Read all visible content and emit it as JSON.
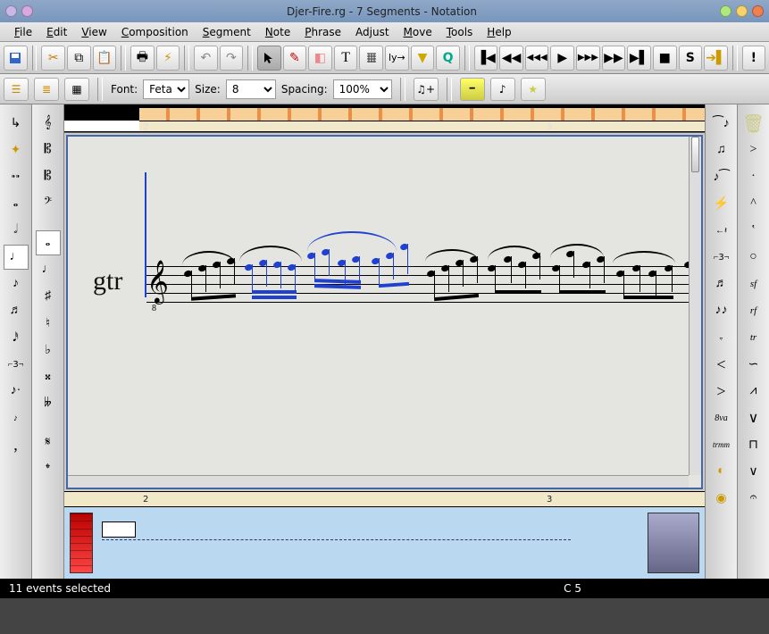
{
  "window": {
    "title": "Djer-Fire.rg - 7 Segments - Notation"
  },
  "menu": {
    "items": [
      "File",
      "Edit",
      "View",
      "Composition",
      "Segment",
      "Note",
      "Phrase",
      "Adjust",
      "Move",
      "Tools",
      "Help"
    ]
  },
  "toolbar_main": {
    "save": "save-icon",
    "cut": "cut-icon",
    "copy": "copy-icon",
    "paste": "paste-icon",
    "print": "print-icon",
    "preview": "preview-icon",
    "undo": "undo-icon",
    "redo": "redo-icon",
    "select": "arrow-icon",
    "draw": "pencil-icon",
    "erase": "eraser-icon",
    "text": "T",
    "guitar": "fret-icon",
    "lilypond": "ly-icon",
    "filter": "filter-icon",
    "event": "Q",
    "transport": {
      "rewind_start": "⏮",
      "rewind": "◀◀",
      "fast_rewind": "◀◀◀",
      "play": "▶",
      "fast_forward": "▶▶▶",
      "forward": "▶▶",
      "forward_end": "⏭",
      "stop": "■",
      "solo": "S",
      "panic": "!"
    }
  },
  "optbar": {
    "font_label": "Font:",
    "font_value": "Feta",
    "size_label": "Size:",
    "size_value": "8",
    "spacing_label": "Spacing:",
    "spacing_value": "100%"
  },
  "ruler": {
    "markers": [
      "2",
      "3"
    ]
  },
  "score": {
    "staff_label": "gtr",
    "clef": "treble-8",
    "selected_note_count": 11
  },
  "left_palette_1": {
    "items": [
      "insert-icon",
      "rest-icon",
      "tie-icon",
      "circle-icon",
      "half-icon",
      "quarter-icon",
      "eighth-icon",
      "sixteenth-icon",
      "thirtysecond-icon",
      "triplet-icon",
      "dotted-icon",
      "grace-icon",
      "cut-time-icon"
    ]
  },
  "left_palette_2": {
    "items": [
      "treble-clef-icon",
      "alto-clef-icon",
      "tenor-clef-icon",
      "bass-clef-icon",
      "whole-note-icon",
      "quarter-note-icon",
      "sharp-icon",
      "natural-icon",
      "flat-icon",
      "double-sharp-icon",
      "double-flat-icon",
      "segno-icon",
      "coda-icon"
    ]
  },
  "right_palette_1": {
    "items": [
      "tie-icon",
      "slur-icon",
      "glissando-icon",
      "dynamic-icon",
      "rest-icon",
      "tuplet-icon",
      "chord-icon",
      "ornament-icon",
      "tremolo-icon",
      "crescendo-icon",
      "decrescendo-icon",
      "ottava-icon",
      "trill-mark-icon",
      "highlight-icon",
      "marker-icon"
    ]
  },
  "right_palette_2": {
    "items": [
      "trash-icon",
      "accent-icon",
      "marcato-icon",
      "staccato-icon",
      "tenuto-icon",
      "whole-icon",
      "ff-icon",
      "sf-icon",
      "rf-icon",
      "tr-icon",
      "turn-icon",
      "mordent-icon",
      "inv-mordent-icon",
      "fermata-icon",
      "pause-icon"
    ]
  },
  "status": {
    "left": "11 events selected",
    "right": "C 5"
  },
  "ottava_label": "8va",
  "trill_label": "trmm",
  "triplet_label": "3"
}
